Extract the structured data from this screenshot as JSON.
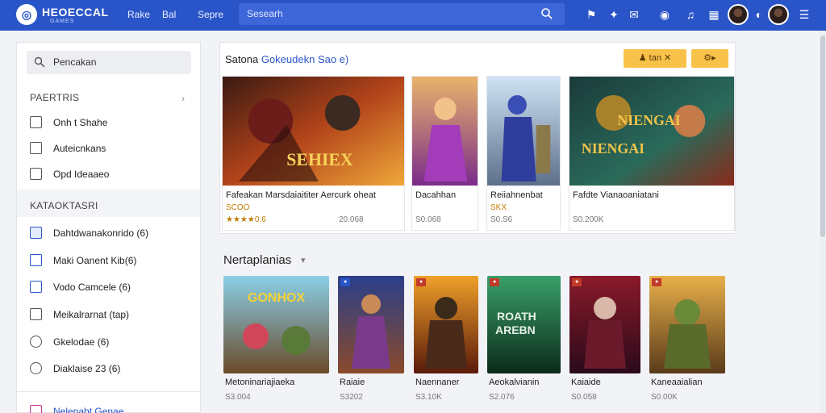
{
  "header": {
    "brand": "HEOECCAL",
    "brand_sub": "GAMES",
    "nav": [
      "Rake",
      "Bal",
      "Sepre"
    ],
    "search_placeholder": "Sesearh"
  },
  "sidebar": {
    "search_label": "Pencakan",
    "section1": "PAERTRIS",
    "items1": [
      "Onh t Shahe",
      "Auteicnkans",
      "Opd Ideaaeo"
    ],
    "section2": "KATAOKTASRI",
    "items2": [
      "Dahtdwanakonrido (6)",
      "Maki Oanent Kib(6)",
      "Vodo Camcele (6)",
      "Meikalrarnat (tap)",
      "Gkelodae (6)",
      "Diaklaise 23 (6)"
    ],
    "items3": [
      "Nelenabt Genae"
    ]
  },
  "featured": {
    "title_prefix": "Satona",
    "title_link": "Gokeudekn Sao e)",
    "pill1": "tan",
    "pill2": "",
    "cards": [
      {
        "title": "Fafeakan Marsdaiaititer Aercurk oheat",
        "sub": "SCOO",
        "rating": "★★★★0.6",
        "price": "20.068",
        "art_text": "SEHIEX"
      },
      {
        "title": "Dacahhan",
        "sub": "",
        "rating": "S0.068",
        "price": "",
        "art_text": ""
      },
      {
        "title": "Reiiahnenbat",
        "sub": "SKX",
        "rating": "S0.S6",
        "price": "",
        "art_text": ""
      },
      {
        "title": "Fafdte Vianaoaniatani",
        "sub": "",
        "rating": "S0.200K",
        "price": "",
        "art_text": "NIENGAI"
      }
    ]
  },
  "new_releases": {
    "title": "Nertaplanias",
    "cards": [
      {
        "title": "Metoninariajiaeka",
        "meta": "S3.004",
        "art_text": "GONHOX"
      },
      {
        "title": "Raiaie",
        "meta": "S3202",
        "art_text": ""
      },
      {
        "title": "Naennaner",
        "meta": "S3.10K",
        "art_text": ""
      },
      {
        "title": "Aeokalvianin",
        "meta": "S2.076",
        "art_text": "ROATH AREBN"
      },
      {
        "title": "Kaiaide",
        "meta": "S0.058",
        "art_text": ""
      },
      {
        "title": "Kaneaaialian",
        "meta": "S0.00K",
        "art_text": ""
      }
    ]
  },
  "colors": {
    "topbar": "#2a55c8",
    "accent": "#2a55c8",
    "pill": "#f7c14a"
  }
}
